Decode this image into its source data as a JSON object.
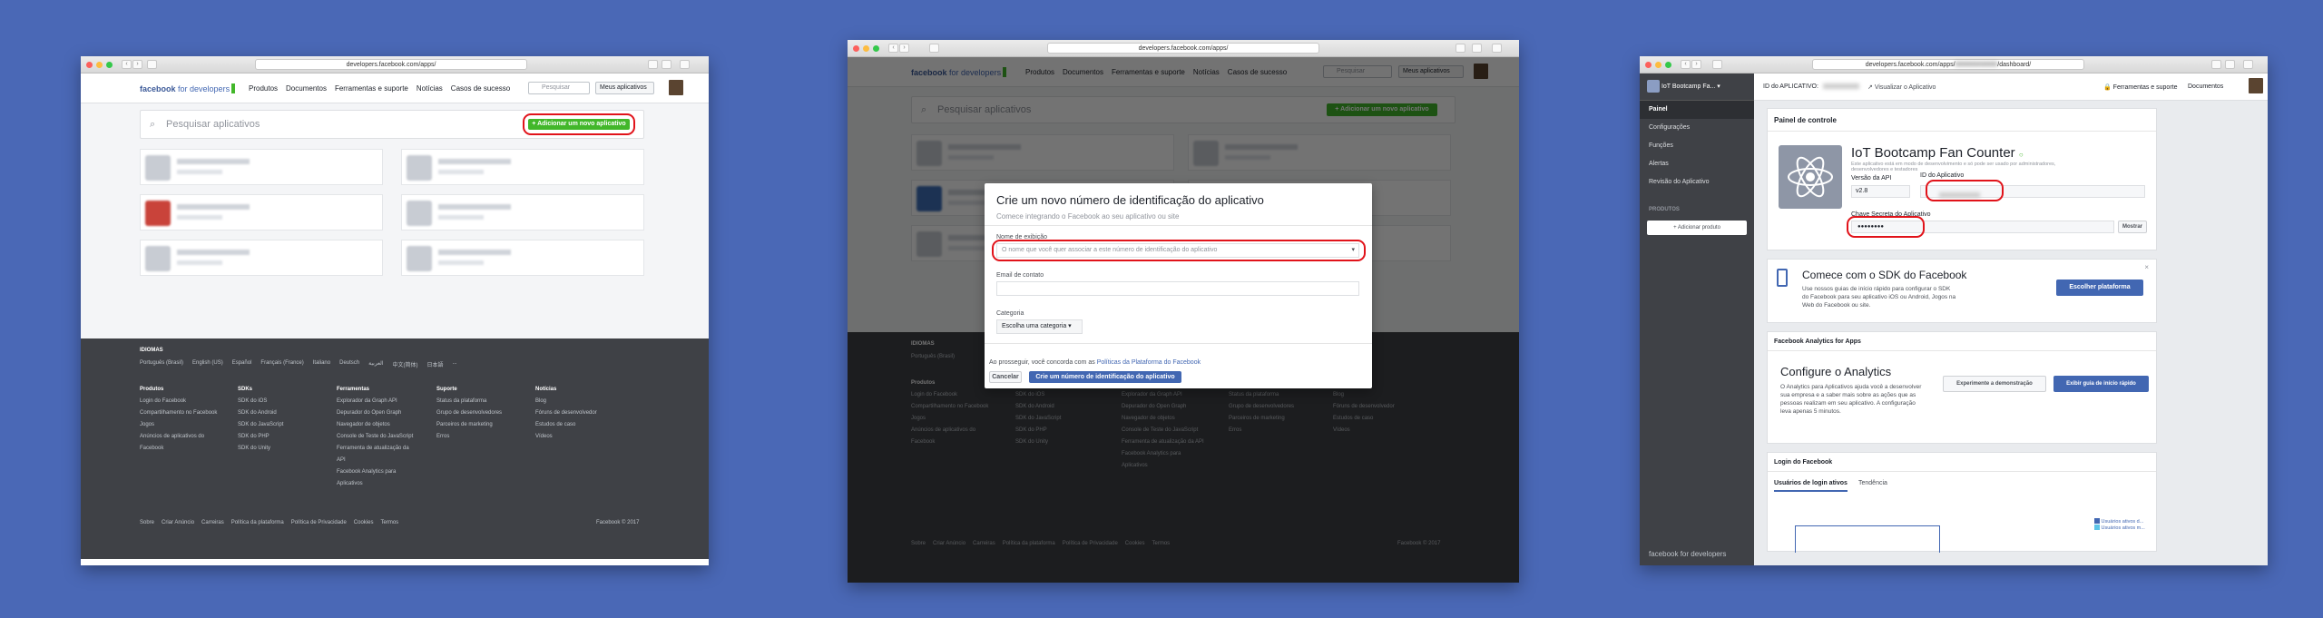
{
  "w1": {
    "url": "developers.facebook.com/apps/",
    "logo": "facebook",
    "logo_sub": "for developers",
    "nav": [
      "Produtos",
      "Documentos",
      "Ferramentas e suporte",
      "Notícias",
      "Casos de sucesso"
    ],
    "search_placeholder": "Pesquisar",
    "my_apps": "Meus aplicativos",
    "search_apps": "Pesquisar aplicativos",
    "add_app": "+ Adicionar um novo aplicativo",
    "footer": {
      "languages_title": "IDIOMAS",
      "languages": [
        "Português (Brasil)",
        "English (US)",
        "Español",
        "Français (France)",
        "Italiano",
        "Deutsch",
        "العربية",
        "中文(简体)",
        "日本語",
        "..."
      ],
      "cols": [
        {
          "title": "Produtos",
          "items": [
            "Login do Facebook",
            "Compartilhamento no Facebook",
            "Jogos",
            "Anúncios de aplicativos do Facebook"
          ]
        },
        {
          "title": "SDKs",
          "items": [
            "SDK do iOS",
            "SDK do Android",
            "SDK do JavaScript",
            "SDK do PHP",
            "SDK do Unity"
          ]
        },
        {
          "title": "Ferramentas",
          "items": [
            "Explorador da Graph API",
            "Depurador do Open Graph",
            "Navegador de objetos",
            "Console de Teste do JavaScript",
            "Ferramenta de atualização da API",
            "Facebook Analytics para Aplicativos"
          ]
        },
        {
          "title": "Suporte",
          "items": [
            "Status da plataforma",
            "Grupo de desenvolvedores",
            "Parceiros de marketing",
            "Erros"
          ]
        },
        {
          "title": "Notícias",
          "items": [
            "Blog",
            "Fóruns de desenvolvedor",
            "Estudos de caso",
            "Vídeos"
          ]
        }
      ],
      "bottom_links": [
        "Sobre",
        "Criar Anúncio",
        "Carreiras",
        "Política da plataforma",
        "Política de Privacidade",
        "Cookies",
        "Termos"
      ],
      "copyright": "Facebook © 2017"
    }
  },
  "w2": {
    "url": "developers.facebook.com/apps/",
    "modal": {
      "title": "Crie um novo número de identificação do aplicativo",
      "subtitle": "Comece integrando o Facebook ao seu aplicativo ou site",
      "display_name_label": "Nome de exibição",
      "display_name_placeholder": "O nome que você quer associar a este número de identificação do aplicativo",
      "email_label": "Email de contato",
      "category_label": "Categoria",
      "category_value": "Escolha uma categoria ▾",
      "terms_prefix": "Ao prosseguir, você concorda com as",
      "terms_link": "Políticas da Plataforma do Facebook",
      "cancel": "Cancelar",
      "create": "Crie um número de identificação do aplicativo"
    }
  },
  "w3": {
    "url": "developers.facebook.com/apps/",
    "url_suffix": "/dashboard/",
    "app_name": "IoT Bootcamp Fa... ▾",
    "app_id_label": "ID do APLICATIVO:",
    "view_app": "Visualizar o Aplicativo",
    "tools": "Ferramentas e suporte",
    "docs": "Documentos",
    "sidebar": [
      "Painel",
      "Configurações",
      "Funções",
      "Alertas",
      "Revisão do Aplicativo"
    ],
    "products_label": "PRODUTOS",
    "add_product": "+ Adicionar produto",
    "dashboard_title": "Painel de controle",
    "app_title": "IoT Bootcamp Fan Counter",
    "app_desc": "Este aplicativo está em modo de desenvolvimento e só pode ser usado por administradores, desenvolvedores e testadores",
    "api_version_label": "Versão da API",
    "api_version": "v2.8",
    "app_id_field_label": "ID do Aplicativo",
    "secret_label": "Chave Secreta do Aplicativo",
    "secret_value": "●●●●●●●●",
    "show": "Mostrar",
    "sdk_title": "Comece com o SDK do Facebook",
    "sdk_desc": "Use nossos guias de início rápido para configurar o SDK do Facebook para seu aplicativo iOS ou Android, Jogos na Web do Facebook ou site.",
    "choose_platform": "Escolher plataforma",
    "analytics_header": "Facebook Analytics for Apps",
    "analytics_title": "Configure o Analytics",
    "analytics_desc": "O Analytics para Aplicativos ajuda você a desenvolver sua empresa e a saber mais sobre as ações que as pessoas realizam em seu aplicativo. A configuração leva apenas 5 minutos.",
    "demo_btn": "Experimente a demonstração",
    "quickstart_btn": "Exibir guia de início rápido",
    "login_header": "Login do Facebook",
    "login_tabs": [
      "Usuários de login ativos",
      "Tendência"
    ],
    "legend": [
      "Usuários ativos d...",
      "Usuários ativos m..."
    ],
    "footer_logo": "facebook for developers"
  }
}
